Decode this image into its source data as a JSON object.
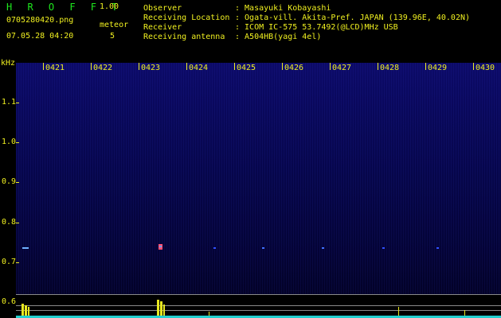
{
  "header": {
    "app_title": "H R O F F T",
    "app_version": "1.00",
    "file_name": "0705280420.png",
    "timestamp": "07.05.28 04:20",
    "meteor_label": "meteor",
    "meteor_count": "5"
  },
  "info": {
    "rows": [
      {
        "label": "Observer",
        "value": ": Masayuki Kobayashi"
      },
      {
        "label": "Receiving Location",
        "value": ": Ogata-vill. Akita-Pref. JAPAN (139.96E, 40.02N)"
      },
      {
        "label": "Receiver",
        "value": ": ICOM IC-575 53.7492(@LCD)MHz USB"
      },
      {
        "label": "Receiving antenna",
        "value": ": A504HB(yagi 4el)"
      }
    ]
  },
  "spectrogram": {
    "unit_label": "kHz",
    "y_labels": [
      "1.1",
      "1.0",
      "0.9",
      "0.8",
      "0.7",
      "0.6"
    ],
    "x_labels": [
      "0421",
      "0422",
      "0423",
      "0424",
      "0425",
      "0426",
      "0427",
      "0428",
      "0429",
      "0430"
    ],
    "colors": {
      "background": "#06064a",
      "labels": "#f0f020",
      "detection": "#e8e820",
      "baseline": "#22d0d0"
    }
  }
}
